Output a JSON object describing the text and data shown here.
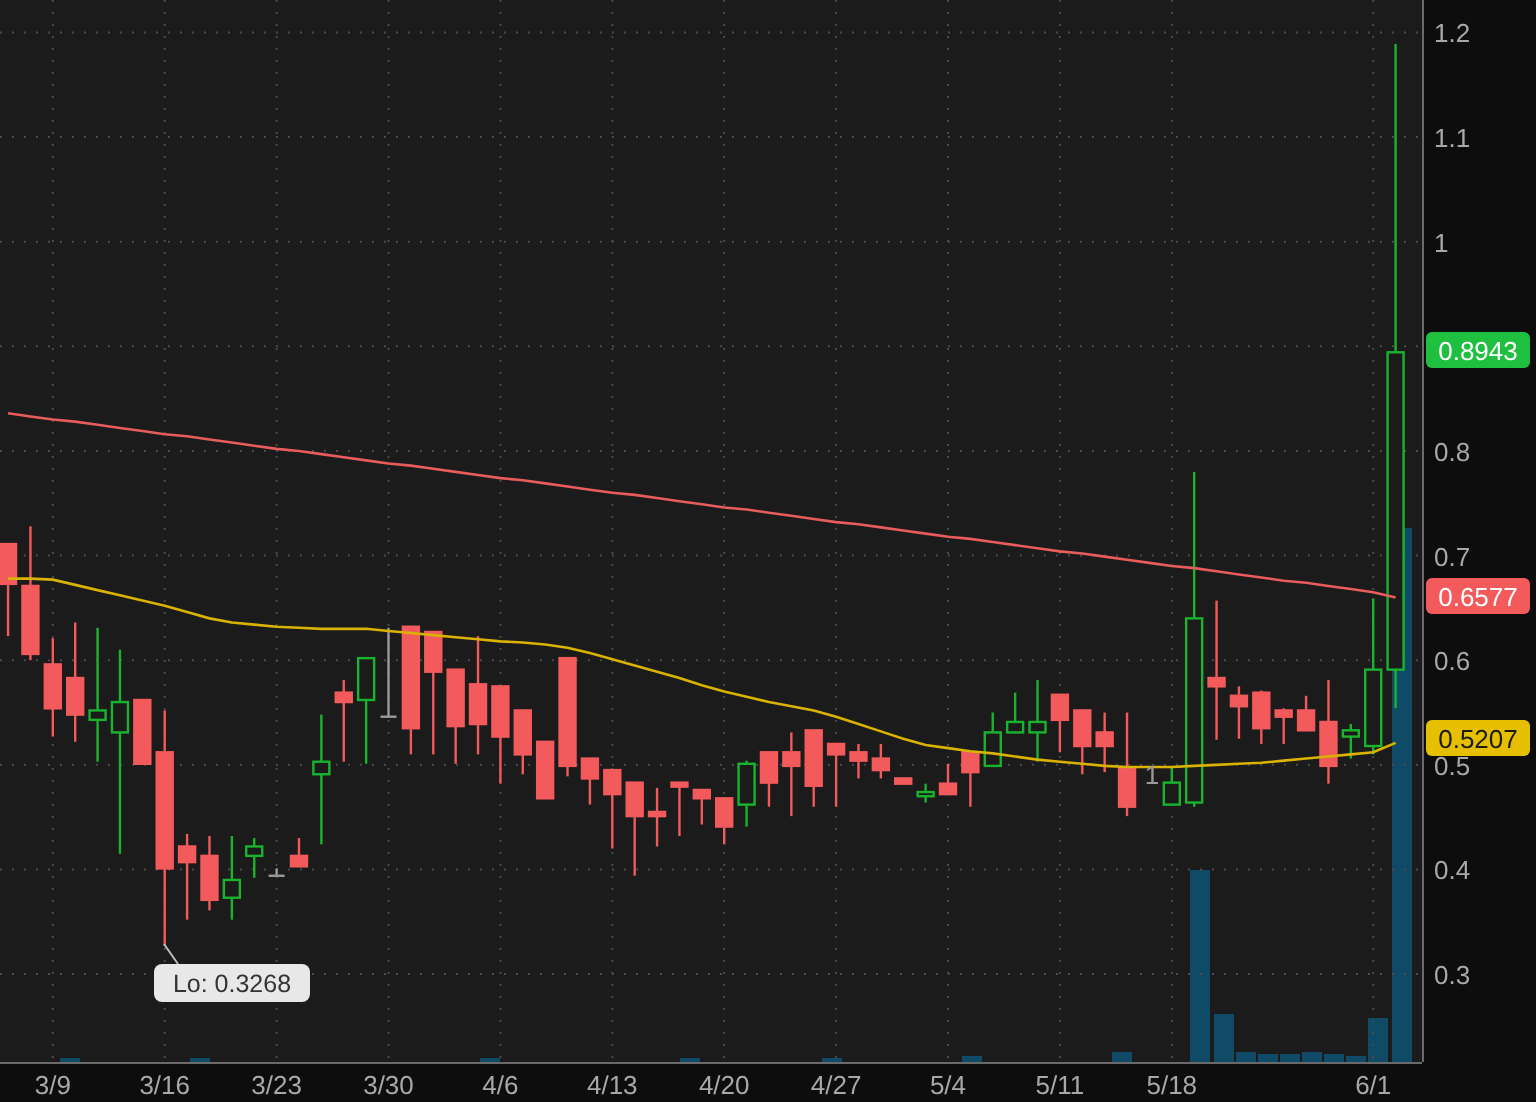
{
  "chart": {
    "chart_data": {
      "type": "candlestick",
      "categories": [
        null,
        null,
        "3/9",
        null,
        null,
        null,
        null,
        "3/16",
        null,
        null,
        null,
        null,
        "3/23",
        null,
        null,
        null,
        null,
        "3/30",
        null,
        null,
        null,
        null,
        "4/6",
        null,
        null,
        null,
        null,
        "4/13",
        null,
        null,
        null,
        null,
        "4/20",
        null,
        null,
        null,
        null,
        "4/27",
        null,
        null,
        null,
        null,
        "5/4",
        null,
        null,
        null,
        null,
        "5/11",
        null,
        null,
        null,
        null,
        "5/18",
        null,
        null,
        null,
        null,
        null,
        null,
        null,
        null,
        "6/1",
        null
      ],
      "ohlc": [
        [
          0.711,
          0.711,
          0.623,
          0.673
        ],
        [
          0.671,
          0.728,
          0.6,
          0.606
        ],
        [
          0.596,
          0.621,
          0.527,
          0.554
        ],
        [
          0.583,
          0.636,
          0.522,
          0.548
        ],
        [
          0.543,
          0.631,
          0.503,
          0.552
        ],
        [
          0.531,
          0.61,
          0.415,
          0.56
        ],
        [
          0.562,
          0.562,
          0.501,
          0.501
        ],
        [
          0.512,
          0.552,
          0.327,
          0.401
        ],
        [
          0.422,
          0.434,
          0.352,
          0.407
        ],
        [
          0.413,
          0.432,
          0.361,
          0.371
        ],
        [
          0.373,
          0.432,
          0.352,
          0.39
        ],
        [
          0.413,
          0.43,
          0.392,
          0.422
        ],
        [
          0.394,
          0.401,
          0.394,
          0.394
        ],
        [
          0.413,
          0.43,
          0.403,
          0.403
        ],
        [
          0.491,
          0.548,
          0.424,
          0.503
        ],
        [
          0.569,
          0.581,
          0.503,
          0.56
        ],
        [
          0.562,
          0.602,
          0.501,
          0.602
        ],
        [
          0.546,
          0.631,
          0.546,
          0.546
        ],
        [
          0.632,
          0.632,
          0.51,
          0.535
        ],
        [
          0.627,
          0.627,
          0.51,
          0.589
        ],
        [
          0.591,
          0.591,
          0.501,
          0.537
        ],
        [
          0.577,
          0.623,
          0.51,
          0.539
        ],
        [
          0.575,
          0.575,
          0.482,
          0.527
        ],
        [
          0.552,
          0.552,
          0.491,
          0.51
        ],
        [
          0.522,
          0.522,
          0.468,
          0.468
        ],
        [
          0.602,
          0.602,
          0.489,
          0.499
        ],
        [
          0.506,
          0.506,
          0.462,
          0.487
        ],
        [
          0.495,
          0.495,
          0.42,
          0.472
        ],
        [
          0.483,
          0.483,
          0.394,
          0.451
        ],
        [
          0.455,
          0.478,
          0.422,
          0.451
        ],
        [
          0.483,
          0.483,
          0.432,
          0.48
        ],
        [
          0.476,
          0.476,
          0.443,
          0.468
        ],
        [
          0.468,
          0.468,
          0.424,
          0.441
        ],
        [
          0.462,
          0.504,
          0.441,
          0.501
        ],
        [
          0.512,
          0.512,
          0.46,
          0.483
        ],
        [
          0.512,
          0.531,
          0.451,
          0.499
        ],
        [
          0.533,
          0.533,
          0.46,
          0.48
        ],
        [
          0.52,
          0.52,
          0.46,
          0.51
        ],
        [
          0.512,
          0.52,
          0.487,
          0.504
        ],
        [
          0.506,
          0.52,
          0.487,
          0.495
        ],
        [
          0.487,
          0.487,
          0.482,
          0.482
        ],
        [
          0.47,
          0.482,
          0.464,
          0.474
        ],
        [
          0.482,
          0.501,
          0.472,
          0.472
        ],
        [
          0.512,
          0.512,
          0.46,
          0.493
        ],
        [
          0.499,
          0.55,
          0.499,
          0.531
        ],
        [
          0.531,
          0.569,
          0.531,
          0.541
        ],
        [
          0.531,
          0.581,
          0.503,
          0.541
        ],
        [
          0.567,
          0.567,
          0.512,
          0.543
        ],
        [
          0.552,
          0.552,
          0.491,
          0.518
        ],
        [
          0.531,
          0.55,
          0.493,
          0.518
        ],
        [
          0.497,
          0.55,
          0.451,
          0.46
        ],
        null,
        [
          0.462,
          0.497,
          0.462,
          0.483
        ],
        [
          0.464,
          0.78,
          0.46,
          0.64
        ],
        [
          0.583,
          0.657,
          0.524,
          0.575
        ],
        [
          0.566,
          0.575,
          0.525,
          0.556
        ],
        [
          0.569,
          0.571,
          0.52,
          0.535
        ],
        [
          0.552,
          0.554,
          0.52,
          0.546
        ],
        [
          0.552,
          0.566,
          0.533,
          0.533
        ],
        [
          0.541,
          0.581,
          0.482,
          0.499
        ],
        [
          0.527,
          0.539,
          0.506,
          0.533
        ],
        [
          0.518,
          0.659,
          0.51,
          0.591
        ],
        [
          0.591,
          1.189,
          0.554,
          0.8943
        ]
      ],
      "series": [
        {
          "type": "line",
          "color": "#e85c5c",
          "values": [
            0.836,
            0.833,
            0.83,
            0.828,
            0.825,
            0.822,
            0.819,
            0.816,
            0.814,
            0.811,
            0.808,
            0.805,
            0.802,
            0.8,
            0.797,
            0.794,
            0.791,
            0.788,
            0.786,
            0.783,
            0.78,
            0.777,
            0.774,
            0.772,
            0.769,
            0.766,
            0.763,
            0.76,
            0.758,
            0.755,
            0.752,
            0.749,
            0.746,
            0.744,
            0.741,
            0.738,
            0.735,
            0.732,
            0.73,
            0.727,
            0.724,
            0.721,
            0.718,
            0.716,
            0.713,
            0.71,
            0.707,
            0.704,
            0.702,
            0.699,
            0.696,
            0.693,
            0.69,
            0.688,
            0.685,
            0.682,
            0.679,
            0.676,
            0.674,
            0.671,
            0.668,
            0.665,
            0.66
          ]
        },
        {
          "type": "line",
          "color": "#d9b300",
          "values": [
            0.678,
            0.678,
            0.677,
            0.672,
            0.667,
            0.662,
            0.657,
            0.652,
            0.646,
            0.64,
            0.636,
            0.634,
            0.632,
            0.631,
            0.63,
            0.63,
            0.63,
            0.628,
            0.626,
            0.624,
            0.622,
            0.62,
            0.618,
            0.617,
            0.615,
            0.612,
            0.607,
            0.601,
            0.595,
            0.589,
            0.583,
            0.576,
            0.57,
            0.565,
            0.56,
            0.556,
            0.552,
            0.546,
            0.539,
            0.532,
            0.525,
            0.519,
            0.516,
            0.513,
            0.511,
            0.508,
            0.505,
            0.503,
            0.501,
            0.499,
            0.498,
            0.498,
            0.498,
            0.499,
            0.5,
            0.501,
            0.502,
            0.504,
            0.506,
            0.508,
            0.51,
            0.512,
            0.521
          ]
        }
      ],
      "ylim": [
        0.216,
        1.231
      ],
      "grid": true,
      "yticks": [
        0.3,
        0.4,
        0.5,
        0.6,
        0.7,
        0.8,
        1,
        1.1,
        1.2
      ]
    },
    "price_tags": [
      {
        "text": "0.8943",
        "color": "#1fbf3f"
      },
      {
        "text": "0.6577",
        "color": "#f25a5c"
      },
      {
        "text": "0.5207",
        "color": "#e6c000"
      }
    ],
    "low_callout": "Lo: 0.3268",
    "event_marker": "1"
  }
}
